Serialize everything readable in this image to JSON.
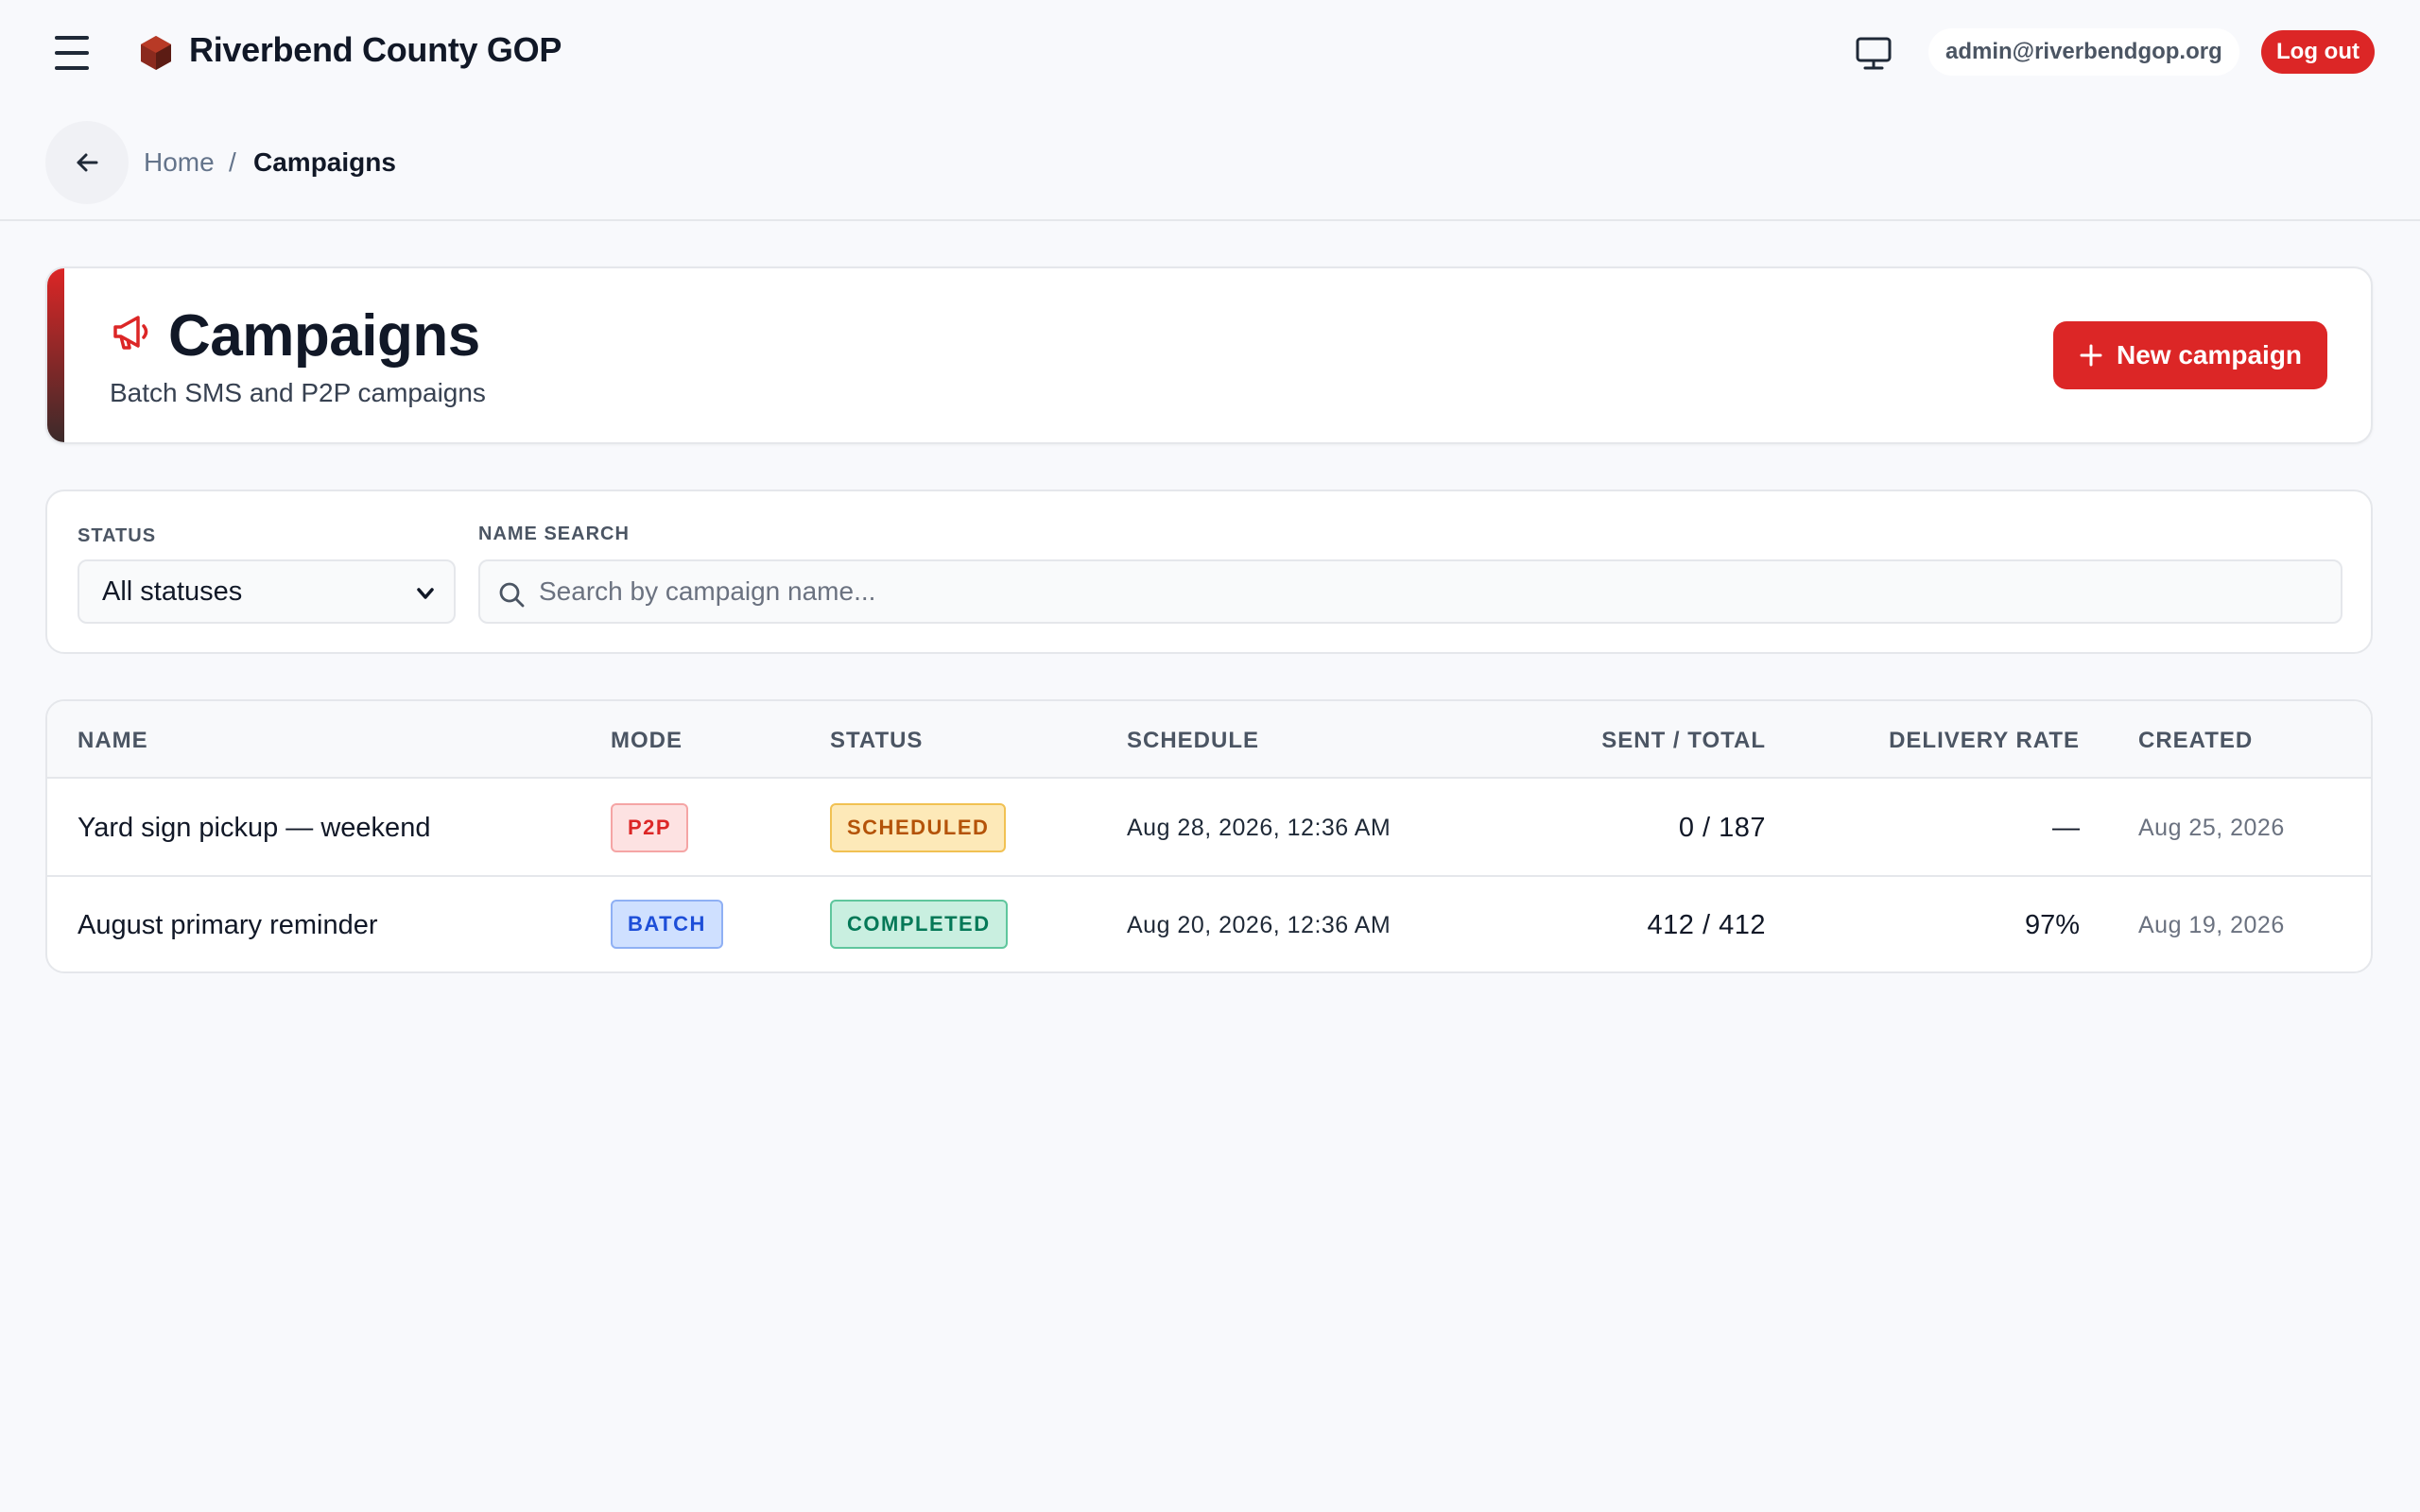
{
  "header": {
    "brand_name": "Riverbend County GOP",
    "user_email": "admin@riverbendgop.org",
    "logout_label": "Log out",
    "menu_icon": "hamburger-icon",
    "display_icon": "monitor-icon"
  },
  "breadcrumb": {
    "home": "Home",
    "separator": "/",
    "current": "Campaigns"
  },
  "page": {
    "title": "Campaigns",
    "subtitle": "Batch SMS and P2P campaigns",
    "new_button_label": "New campaign",
    "title_icon": "megaphone-icon",
    "accent_color": "#dc2626"
  },
  "filters": {
    "status_label": "STATUS",
    "status_value": "All statuses",
    "search_label": "NAME SEARCH",
    "search_placeholder": "Search by campaign name..."
  },
  "table": {
    "columns": [
      "NAME",
      "MODE",
      "STATUS",
      "SCHEDULE",
      "SENT / TOTAL",
      "DELIVERY RATE",
      "CREATED"
    ],
    "rows": [
      {
        "name": "Yard sign pickup — weekend",
        "mode": "P2P",
        "status": "SCHEDULED",
        "schedule": "Aug 28, 2026, 12:36 AM",
        "sent_total": "0 / 187",
        "delivery_rate": "—",
        "created": "Aug 25, 2026"
      },
      {
        "name": "August primary reminder",
        "mode": "BATCH",
        "status": "COMPLETED",
        "schedule": "Aug 20, 2026, 12:36 AM",
        "sent_total": "412 / 412",
        "delivery_rate": "97%",
        "created": "Aug 19, 2026"
      }
    ]
  }
}
